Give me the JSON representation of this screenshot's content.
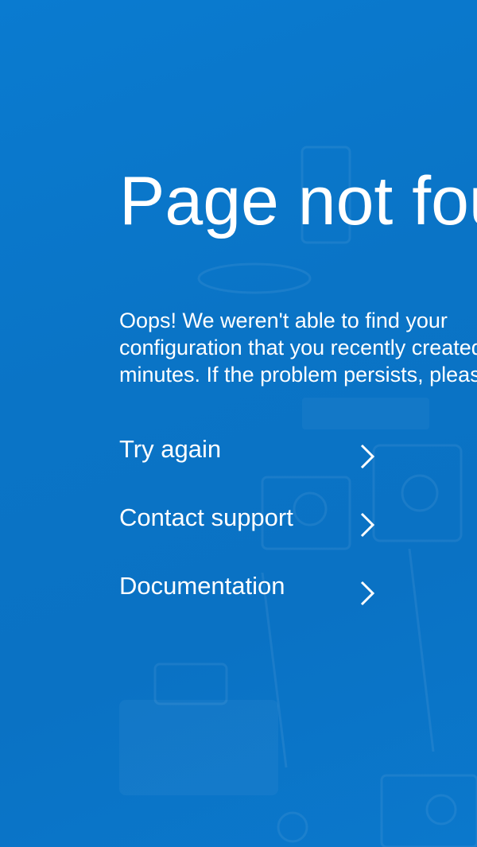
{
  "page": {
    "title": "Page not found",
    "message_lines": [
      "Oops! We weren't able to find your",
      "configuration that you recently created",
      "minutes. If the problem persists, please"
    ],
    "background_color": "#0a74c6",
    "text_color": "#ffffff"
  },
  "links": [
    {
      "label": "Try again",
      "icon": "chevron-right-icon"
    },
    {
      "label": "Contact support",
      "icon": "chevron-right-icon"
    },
    {
      "label": "Documentation",
      "icon": "chevron-right-icon"
    }
  ]
}
